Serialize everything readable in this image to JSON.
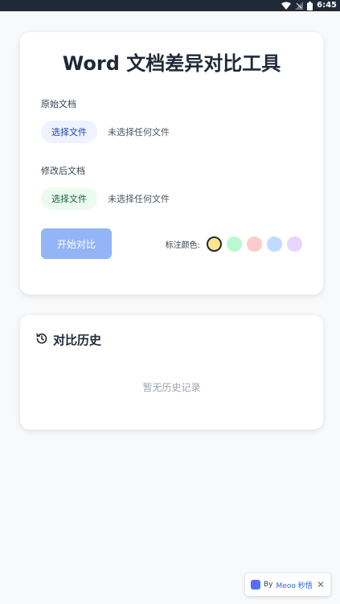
{
  "status_bar": {
    "time": "6:45"
  },
  "main": {
    "title": "Word 文档差异对比工具",
    "original": {
      "label": "原始文档",
      "button": "选择文件",
      "status": "未选择任何文件"
    },
    "modified": {
      "label": "修改后文档",
      "button": "选择文件",
      "status": "未选择任何文件"
    },
    "compare_button": "开始对比",
    "colors_label": "标注颜色:",
    "colors": [
      "#fde68a",
      "#bbf7d0",
      "#fecaca",
      "#bfdbfe",
      "#e9d5ff"
    ],
    "selected_color_index": 0
  },
  "history": {
    "title": "对比历史",
    "empty": "暂无历史记录"
  },
  "badge": {
    "prefix": "By",
    "brand": "Meoo 秒悟",
    "close": "✕"
  }
}
